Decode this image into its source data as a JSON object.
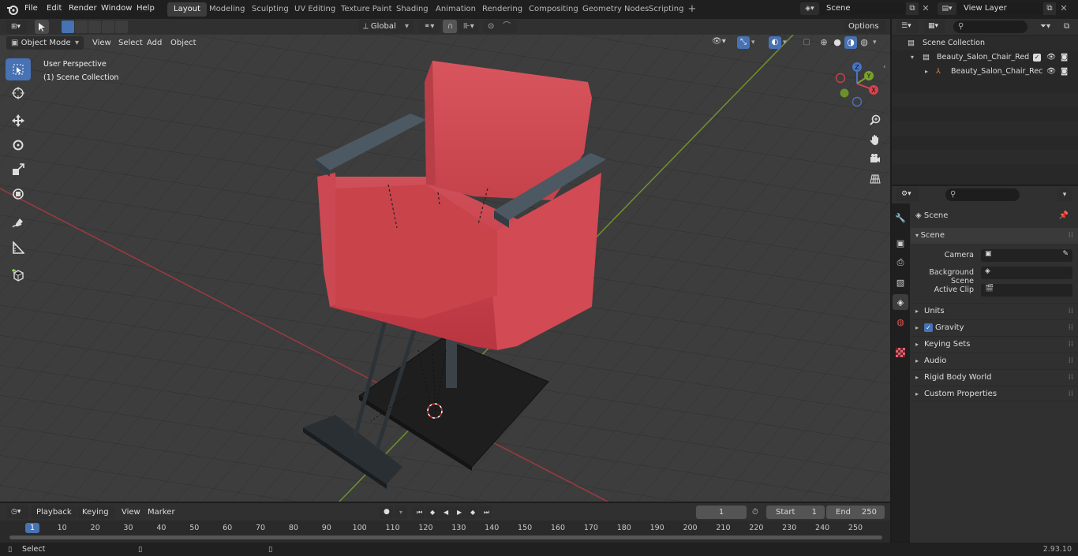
{
  "menus": [
    "File",
    "Edit",
    "Render",
    "Window",
    "Help"
  ],
  "workspaces": [
    "Layout",
    "Modeling",
    "Sculpting",
    "UV Editing",
    "Texture Paint",
    "Shading",
    "Animation",
    "Rendering",
    "Compositing",
    "Geometry Nodes",
    "Scripting"
  ],
  "active_workspace": "Layout",
  "scene_name": "Scene",
  "view_layer": "View Layer",
  "header": {
    "mode": "Object Mode",
    "menus": [
      "View",
      "Select",
      "Add",
      "Object"
    ],
    "orientation": "Global",
    "options": "Options"
  },
  "viewport": {
    "perspective": "User Perspective",
    "collection": "(1) Scene Collection"
  },
  "gizmo": {
    "x": "X",
    "y": "Y",
    "z": "Z"
  },
  "outliner": {
    "root": "Scene Collection",
    "items": [
      {
        "label": "Beauty_Salon_Chair_Red"
      },
      {
        "label": "Beauty_Salon_Chair_Rec"
      }
    ]
  },
  "props": {
    "header": "Scene",
    "section": "Scene",
    "camera_label": "Camera",
    "bg_label": "Background Scene",
    "clip_label": "Active Clip",
    "panels": [
      "Units",
      "Gravity",
      "Keying Sets",
      "Audio",
      "Rigid Body World",
      "Custom Properties"
    ]
  },
  "timeline": {
    "menus": [
      "Playback",
      "Keying",
      "View",
      "Marker"
    ],
    "current_frame": "1",
    "start_label": "Start",
    "start": "1",
    "end_label": "End",
    "end": "250",
    "ticks": [
      "1",
      "10",
      "20",
      "30",
      "40",
      "50",
      "60",
      "70",
      "80",
      "90",
      "100",
      "110",
      "120",
      "130",
      "140",
      "150",
      "160",
      "170",
      "180",
      "190",
      "200",
      "210",
      "220",
      "230",
      "240",
      "250"
    ]
  },
  "status": {
    "select": "Select",
    "version": "2.93.10"
  },
  "colors": {
    "accent": "#4772b3",
    "chair": "#c9434b",
    "x_axis": "#b3383f",
    "y_axis": "#7aa12e"
  }
}
